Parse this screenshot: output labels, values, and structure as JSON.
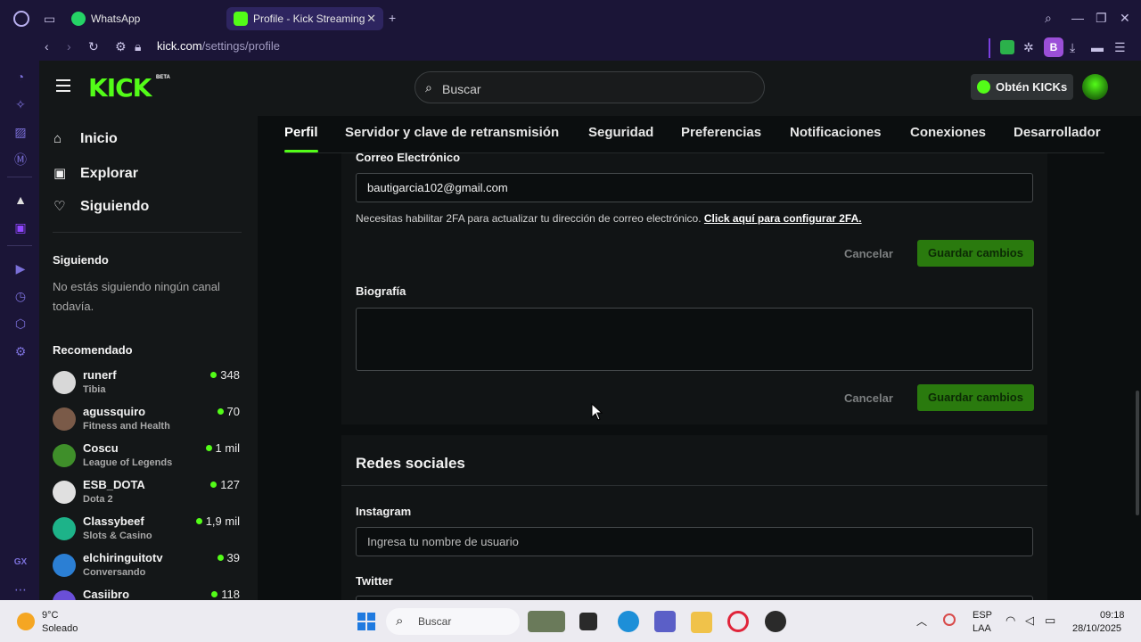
{
  "browser": {
    "tabs": [
      {
        "label": "WhatsApp",
        "active": false
      },
      {
        "label": "Profile - Kick Streaming",
        "active": true
      }
    ],
    "new_tab": "+",
    "url_domain": "kick.com",
    "url_path": "/settings/profile",
    "profile_initial": "B"
  },
  "kick": {
    "logo": "KICK",
    "logo_badge": "BETA",
    "search_placeholder": "Buscar",
    "kicks_button": "Obtén KICKs",
    "nav": [
      {
        "label": "Inicio",
        "icon": "home-icon"
      },
      {
        "label": "Explorar",
        "icon": "compass-icon"
      },
      {
        "label": "Siguiendo",
        "icon": "heart-icon"
      }
    ],
    "following_title": "Siguiendo",
    "following_empty": "No estás siguiendo ningún canal todavía.",
    "recommended_title": "Recomendado",
    "recommended": [
      {
        "name": "runerf",
        "category": "Tibia",
        "viewers": "348",
        "color": "#d8d8d8"
      },
      {
        "name": "agussquiro",
        "category": "Fitness and Health",
        "viewers": "70",
        "color": "#7a5a48"
      },
      {
        "name": "Coscu",
        "category": "League of Legends",
        "viewers": "1 mil",
        "color": "#3f8f2a"
      },
      {
        "name": "ESB_DOTA",
        "category": "Dota 2",
        "viewers": "127",
        "color": "#e0e0e0"
      },
      {
        "name": "Classybeef",
        "category": "Slots & Casino",
        "viewers": "1,9 mil",
        "color": "#1db389"
      },
      {
        "name": "elchiringuitotv",
        "category": "Conversando",
        "viewers": "39",
        "color": "#2b7fd4"
      },
      {
        "name": "Casiibro",
        "category": "",
        "viewers": "118",
        "color": "#6a4fd8"
      }
    ],
    "settings_tabs": [
      "Perfil",
      "Servidor y clave de retransmisión",
      "Seguridad",
      "Preferencias",
      "Notificaciones",
      "Conexiones",
      "Desarrollador"
    ],
    "email": {
      "label": "Correo Electrónico",
      "value": "bautigarcia102@gmail.com",
      "note": "Necesitas habilitar 2FA para actualizar tu dirección de correo electrónico.",
      "note_link": "Click aquí para configurar 2FA."
    },
    "bio": {
      "label": "Biografía",
      "value": ""
    },
    "cancel_label": "Cancelar",
    "save_label": "Guardar cambios",
    "social": {
      "title": "Redes sociales",
      "instagram_label": "Instagram",
      "instagram_placeholder": "Ingresa tu nombre de usuario",
      "twitter_label": "Twitter"
    }
  },
  "taskbar": {
    "weather_temp": "9°C",
    "weather_desc": "Soleado",
    "search_label": "Buscar",
    "lang": "ESP",
    "layout": "LAA",
    "time": "09:18",
    "date": "28/10/2025"
  }
}
